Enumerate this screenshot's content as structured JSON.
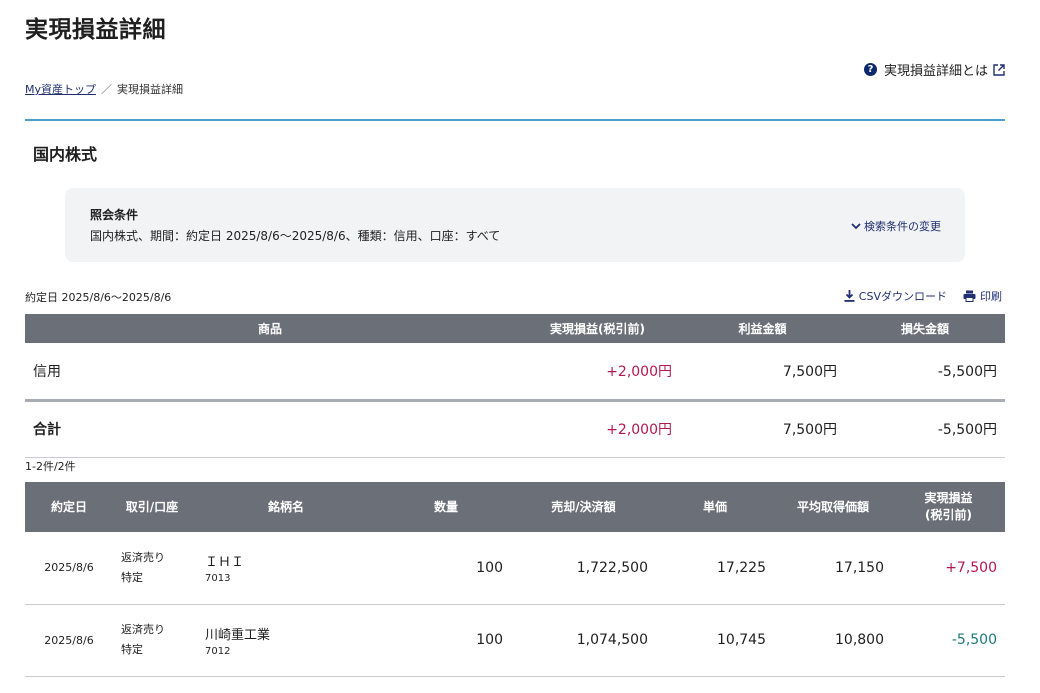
{
  "page": {
    "title": "実現損益詳細",
    "help_link": "実現損益詳細とは"
  },
  "breadcrumb": {
    "home": "My資産トップ",
    "separator": "／",
    "current": "実現損益詳細"
  },
  "section": {
    "title": "国内株式"
  },
  "conditions": {
    "label": "照会条件",
    "text": "国内株式、期間：約定日 2025/8/6〜2025/8/6、種類：信用、口座：すべて",
    "change_label": "検索条件の変更"
  },
  "period_label": "約定日 2025/8/6〜2025/8/6",
  "actions": {
    "csv": "CSVダウンロード",
    "print": "印刷"
  },
  "summary": {
    "headers": [
      "商品",
      "実現損益(税引前)",
      "利益金額",
      "損失金額"
    ],
    "rows": [
      {
        "product": "信用",
        "realized": "+2,000円",
        "profit": "7,500円",
        "loss": "-5,500円"
      }
    ],
    "total": {
      "product": "合計",
      "realized": "+2,000円",
      "profit": "7,500円",
      "loss": "-5,500円"
    }
  },
  "count_label": "1-2件/2件",
  "detail": {
    "headers": {
      "date": "約定日",
      "trade": "取引/口座",
      "stock": "銘柄名",
      "qty": "数量",
      "amount": "売却/決済額",
      "price": "単価",
      "avg": "平均取得価額",
      "realized_1": "実現損益",
      "realized_2": "(税引前)"
    },
    "rows": [
      {
        "date": "2025/8/6",
        "trade": "返済売り",
        "account": "特定",
        "name": "ＩＨＩ",
        "code": "7013",
        "qty": "100",
        "amount": "1,722,500",
        "price": "17,225",
        "avg": "17,150",
        "realized": "+7,500"
      },
      {
        "date": "2025/8/6",
        "trade": "返済売り",
        "account": "特定",
        "name": "川崎重工業",
        "code": "7012",
        "qty": "100",
        "amount": "1,074,500",
        "price": "10,745",
        "avg": "10,800",
        "realized": "-5,500"
      }
    ]
  },
  "colors": {
    "header_bg": "#6b6f77",
    "positive": "#b3184f",
    "negative": "#1b7a7a",
    "link": "#1f2f70",
    "accent_line": "#4a9fd0"
  }
}
